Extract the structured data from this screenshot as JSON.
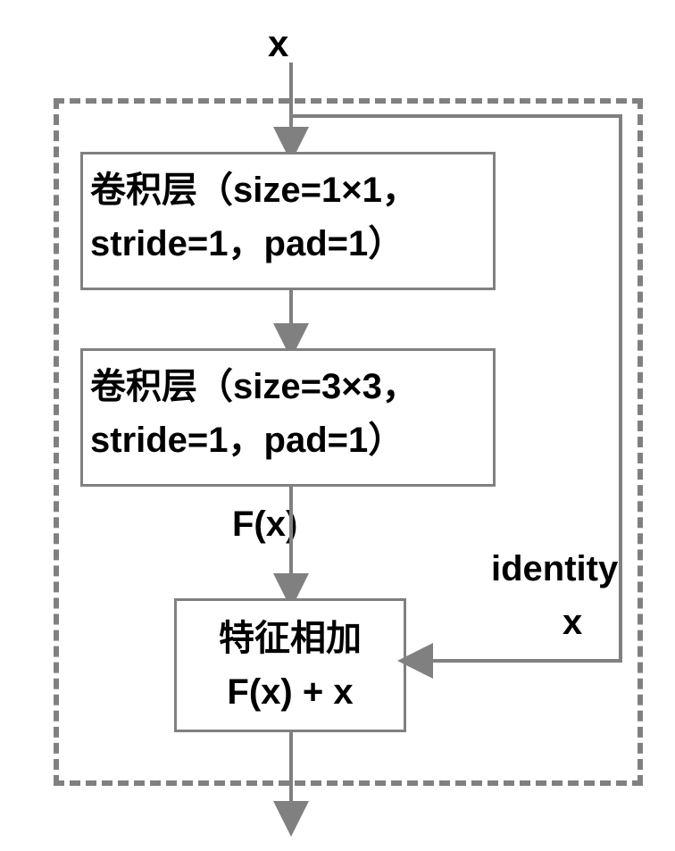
{
  "input_label": "x",
  "conv1": {
    "name": "卷积层",
    "params": "（size=1×1，stride=1，pad=1）"
  },
  "conv2": {
    "name": "卷积层",
    "params": "（size=3×3，stride=1，pad=1）"
  },
  "fx_label": "F(x)",
  "add_block": {
    "title": "特征相加",
    "formula": "F(x) + x"
  },
  "identity_label": "identity",
  "identity_x": "x"
}
